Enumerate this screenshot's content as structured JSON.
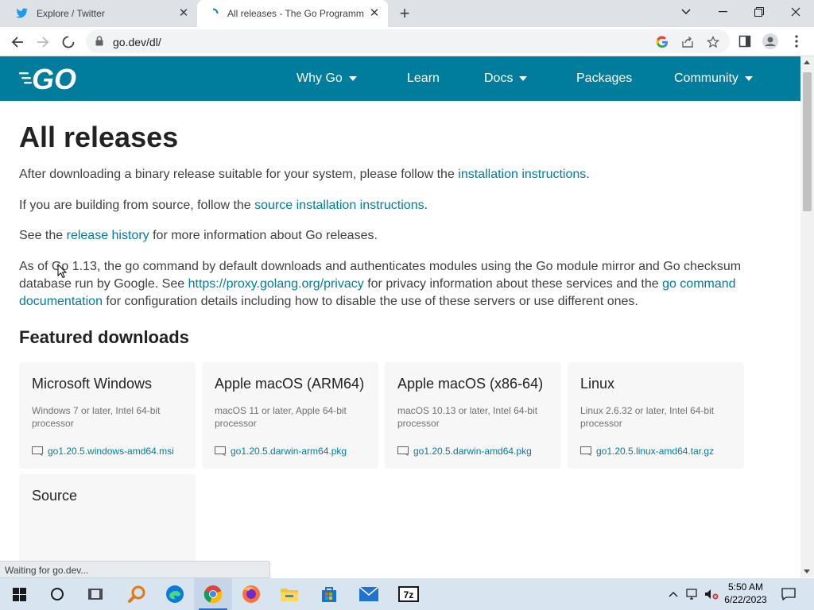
{
  "browser": {
    "tabs": [
      {
        "title": "Explore / Twitter",
        "favicon": "twitter-icon",
        "active": false
      },
      {
        "title": "All releases - The Go Programming Language",
        "favicon": "loading-spinner-icon",
        "active": true
      }
    ],
    "url": "go.dev/dl/",
    "status_text": "Waiting for go.dev..."
  },
  "site": {
    "brand_color": "#007d9c",
    "logo_text": "GO",
    "nav": [
      {
        "label": "Why Go",
        "has_dropdown": true
      },
      {
        "label": "Learn",
        "has_dropdown": false
      },
      {
        "label": "Docs",
        "has_dropdown": true
      },
      {
        "label": "Packages",
        "has_dropdown": false
      },
      {
        "label": "Community",
        "has_dropdown": true
      }
    ]
  },
  "page": {
    "title": "All releases",
    "p1": {
      "before": "After downloading a binary release suitable for your system, please follow the ",
      "link": "installation instructions",
      "after": "."
    },
    "p2": {
      "before": "If you are building from source, follow the ",
      "link": "source installation instructions",
      "after": "."
    },
    "p3": {
      "before": "See the ",
      "link": "release history",
      "after": " for more information about Go releases."
    },
    "p4": {
      "text1": "As of Go 1.13, the go command by default downloads and authenticates modules using the Go module mirror and Go checksum database run by Google. See ",
      "link1": "https://proxy.golang.org/privacy",
      "text2": " for privacy information about these services and the ",
      "link2": "go command documentation",
      "text3": " for configuration details including how to disable the use of these servers or use different ones."
    },
    "featured_title": "Featured downloads",
    "downloads": [
      {
        "os": "Microsoft Windows",
        "desc": "Windows 7 or later, Intel 64-bit processor",
        "file": "go1.20.5.windows-amd64.msi"
      },
      {
        "os": "Apple macOS (ARM64)",
        "desc": "macOS 11 or later, Apple 64-bit processor",
        "file": "go1.20.5.darwin-arm64.pkg"
      },
      {
        "os": "Apple macOS (x86-64)",
        "desc": "macOS 10.13 or later, Intel 64-bit processor",
        "file": "go1.20.5.darwin-amd64.pkg"
      },
      {
        "os": "Linux",
        "desc": "Linux 2.6.32 or later, Intel 64-bit processor",
        "file": "go1.20.5.linux-amd64.tar.gz"
      },
      {
        "os": "Source",
        "desc": "",
        "file": ""
      }
    ]
  },
  "taskbar": {
    "apps": [
      "start-icon",
      "search-icon",
      "task-view-icon",
      "search-app-icon",
      "edge-icon",
      "chrome-icon",
      "firefox-icon",
      "file-explorer-icon",
      "store-icon",
      "mail-icon",
      "7zip-icon"
    ],
    "seven_zip_label": "7z",
    "time": "5:50 AM",
    "date": "6/22/2023"
  }
}
